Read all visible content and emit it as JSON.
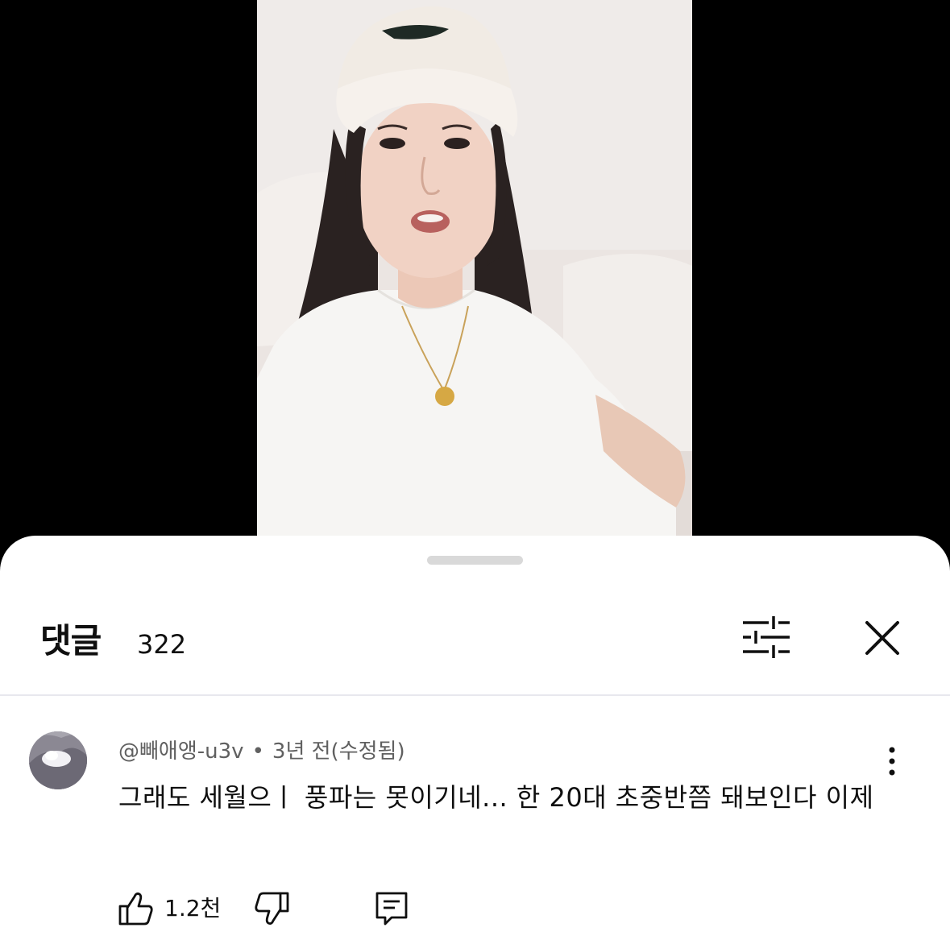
{
  "video": {
    "description_icon": "video-frame"
  },
  "comments_sheet": {
    "title": "댓글",
    "count": "322",
    "icons": {
      "filter": "filter-sliders-icon",
      "close": "close-icon"
    }
  },
  "comment": {
    "author": "@빼애앵-u3v",
    "separator": "•",
    "timestamp": "3년 전(수정됨)",
    "text": "그래도 세월으ㅣ  풍파는 못이기네... 한 20대 초중반쯤 돼보인다 이제",
    "like_count": "1.2천",
    "icons": {
      "avatar": "avatar",
      "more": "more-vertical-icon",
      "like": "thumbs-up-icon",
      "dislike": "thumbs-down-icon",
      "reply": "reply-icon"
    }
  },
  "colors": {
    "sheet_background": "#ffffff",
    "video_background": "#000000",
    "meta_text": "#606060",
    "primary_text": "#0f0f0f"
  }
}
